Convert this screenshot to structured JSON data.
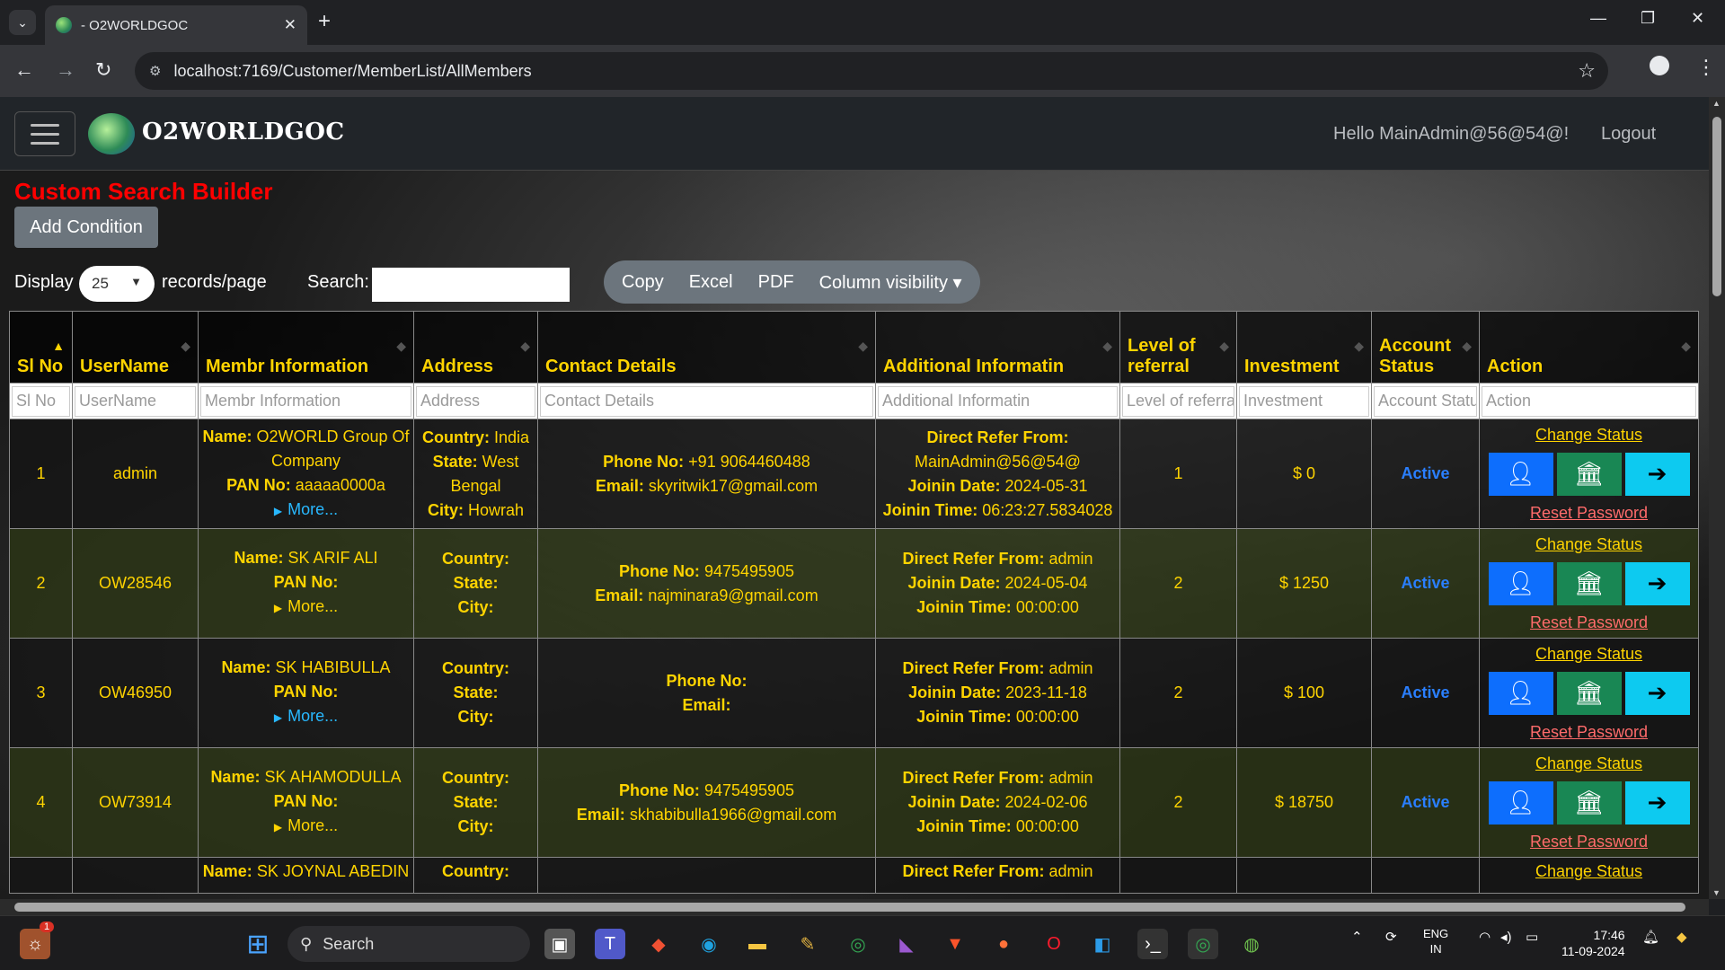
{
  "browser": {
    "tab_title": "- O2WORLDGOC",
    "url": "localhost:7169/Customer/MemberList/AllMembers"
  },
  "navbar": {
    "brand": "O2WORLDGOC",
    "greeting": "Hello MainAdmin@56@54@!",
    "logout": "Logout"
  },
  "search_builder": {
    "title": "Custom Search Builder",
    "add_condition": "Add Condition"
  },
  "controls": {
    "display_label": "Display",
    "page_length": "25",
    "records_label": "records/page",
    "search_label": "Search:",
    "search_value": "",
    "buttons": [
      "Copy",
      "Excel",
      "PDF",
      "Column visibility ▾"
    ]
  },
  "table": {
    "headers": [
      "Sl No",
      "UserName",
      "Membr Information",
      "Address",
      "Contact Details",
      "Additional Informatin",
      "Level of referral",
      "Investment",
      "Account Status",
      "Action"
    ],
    "filters": [
      "Sl No",
      "UserName",
      "Membr Information",
      "Address",
      "Contact Details",
      "Additional Informatin",
      "Level of referral",
      "Investment",
      "Account Status",
      "Action"
    ],
    "labels": {
      "name": "Name:",
      "pan": "PAN No:",
      "more": "More...",
      "country": "Country:",
      "state": "State:",
      "city": "City:",
      "phone": "Phone No:",
      "email": "Email:",
      "direct_refer": "Direct Refer From:",
      "join_date": "Joinin Date:",
      "join_time": "Joinin Time:",
      "change_status": "Change Status",
      "reset_password": "Reset Password"
    },
    "rows": [
      {
        "sl": "1",
        "username": "admin",
        "name": "O2WORLD Group Of Company",
        "pan": "aaaaa0000a",
        "country": "India",
        "state": "West Bengal",
        "city": "Howrah",
        "phone": "+91 9064460488",
        "email": "skyritwik17@gmail.com",
        "refer": "MainAdmin@56@54@",
        "join_date": "2024-05-31",
        "join_time": "06:23:27.5834028",
        "level": "1",
        "investment": "$ 0",
        "status": "Active"
      },
      {
        "sl": "2",
        "username": "OW28546",
        "name": "SK ARIF ALI",
        "pan": "",
        "country": "",
        "state": "",
        "city": "",
        "phone": "9475495905",
        "email": "najminara9@gmail.com",
        "refer": "admin",
        "join_date": "2024-05-04",
        "join_time": "00:00:00",
        "level": "2",
        "investment": "$ 1250",
        "status": "Active"
      },
      {
        "sl": "3",
        "username": "OW46950",
        "name": "SK HABIBULLA",
        "pan": "",
        "country": "",
        "state": "",
        "city": "",
        "phone": "",
        "email": "",
        "refer": "admin",
        "join_date": "2023-11-18",
        "join_time": "00:00:00",
        "level": "2",
        "investment": "$ 100",
        "status": "Active"
      },
      {
        "sl": "4",
        "username": "OW73914",
        "name": "SK AHAMODULLA",
        "pan": "",
        "country": "",
        "state": "",
        "city": "",
        "phone": "9475495905",
        "email": "skhabibulla1966@gmail.com",
        "refer": "admin",
        "join_date": "2024-02-06",
        "join_time": "00:00:00",
        "level": "2",
        "investment": "$ 18750",
        "status": "Active"
      },
      {
        "sl": "",
        "username": "",
        "name": "SK JOYNAL ABEDIN",
        "pan": "",
        "country": "",
        "state": "",
        "city": "",
        "phone": "",
        "email": "",
        "refer": "admin",
        "join_date": "",
        "join_time": "",
        "level": "",
        "investment": "",
        "status": ""
      }
    ]
  },
  "taskbar": {
    "search_placeholder": "Search",
    "lang": "ENG",
    "region": "IN",
    "time": "17:46",
    "date": "11-09-2024",
    "notification_count": "1"
  },
  "colors": {
    "header_text": "#ffd400",
    "title_red": "#ff0000",
    "active_blue": "#2a7fff",
    "reset_link": "#ff6b6b"
  }
}
